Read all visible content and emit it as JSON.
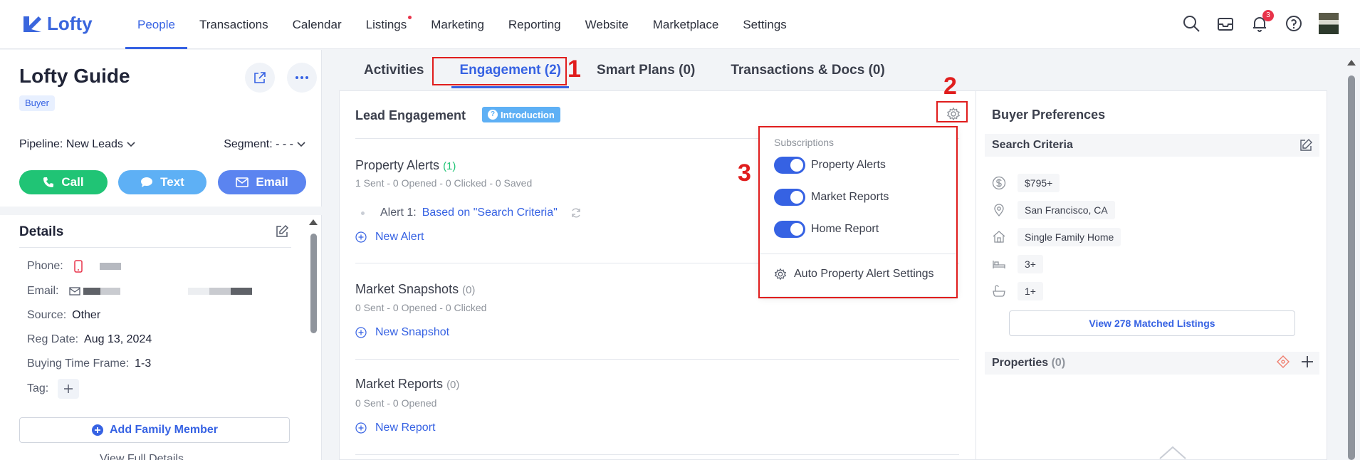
{
  "app": {
    "logo_text": "Lofty"
  },
  "nav": {
    "items": [
      "People",
      "Transactions",
      "Calendar",
      "Listings",
      "Marketing",
      "Reporting",
      "Website",
      "Marketplace",
      "Settings"
    ],
    "active": "People",
    "notification_count": "3"
  },
  "lead": {
    "name": "Lofty Guide",
    "tag": "Buyer",
    "pipeline_label": "Pipeline: New Leads",
    "segment_label": "Segment: - - -",
    "call_label": "Call",
    "text_label": "Text",
    "email_label": "Email"
  },
  "details": {
    "title": "Details",
    "phone_label": "Phone:",
    "email_label": "Email:",
    "source_label": "Source:",
    "source_value": "Other",
    "reg_label": "Reg Date:",
    "reg_value": "Aug 13, 2024",
    "time_label": "Buying Time Frame:",
    "time_value": "1-3",
    "tag_label": "Tag:",
    "add_family": "Add Family Member",
    "view_full": "View Full Details"
  },
  "tabs": [
    "Activities",
    "Engagement (2)",
    "Smart Plans (0)",
    "Transactions & Docs (0)"
  ],
  "annotations": {
    "one": "1",
    "two": "2",
    "three": "3"
  },
  "engagement": {
    "title": "Lead Engagement",
    "intro_label": "Introduction",
    "property_alerts": {
      "title": "Property Alerts",
      "count": "(1)",
      "stats": "1 Sent - 0 Opened - 0 Clicked - 0 Saved",
      "alert_prefix": "Alert 1:",
      "alert_link": "Based on \"Search Criteria\"",
      "new_label": "New Alert"
    },
    "market_snapshots": {
      "title": "Market Snapshots",
      "count": "(0)",
      "stats": "0 Sent - 0 Opened - 0 Clicked",
      "new_label": "New Snapshot"
    },
    "market_reports": {
      "title": "Market Reports",
      "count": "(0)",
      "stats": "0 Sent - 0 Opened",
      "new_label": "New Report"
    }
  },
  "subscriptions": {
    "heading": "Subscriptions",
    "items": [
      "Property Alerts",
      "Market Reports",
      "Home Report"
    ],
    "settings_label": "Auto Property Alert Settings"
  },
  "buyer_prefs": {
    "title": "Buyer Preferences",
    "criteria_title": "Search Criteria",
    "price": "$795+",
    "location": "San Francisco, CA",
    "home_type": "Single Family Home",
    "beds": "3+",
    "baths": "1+",
    "matched_label": "View 278 Matched Listings",
    "properties_title": "Properties",
    "properties_count": "(0)"
  }
}
